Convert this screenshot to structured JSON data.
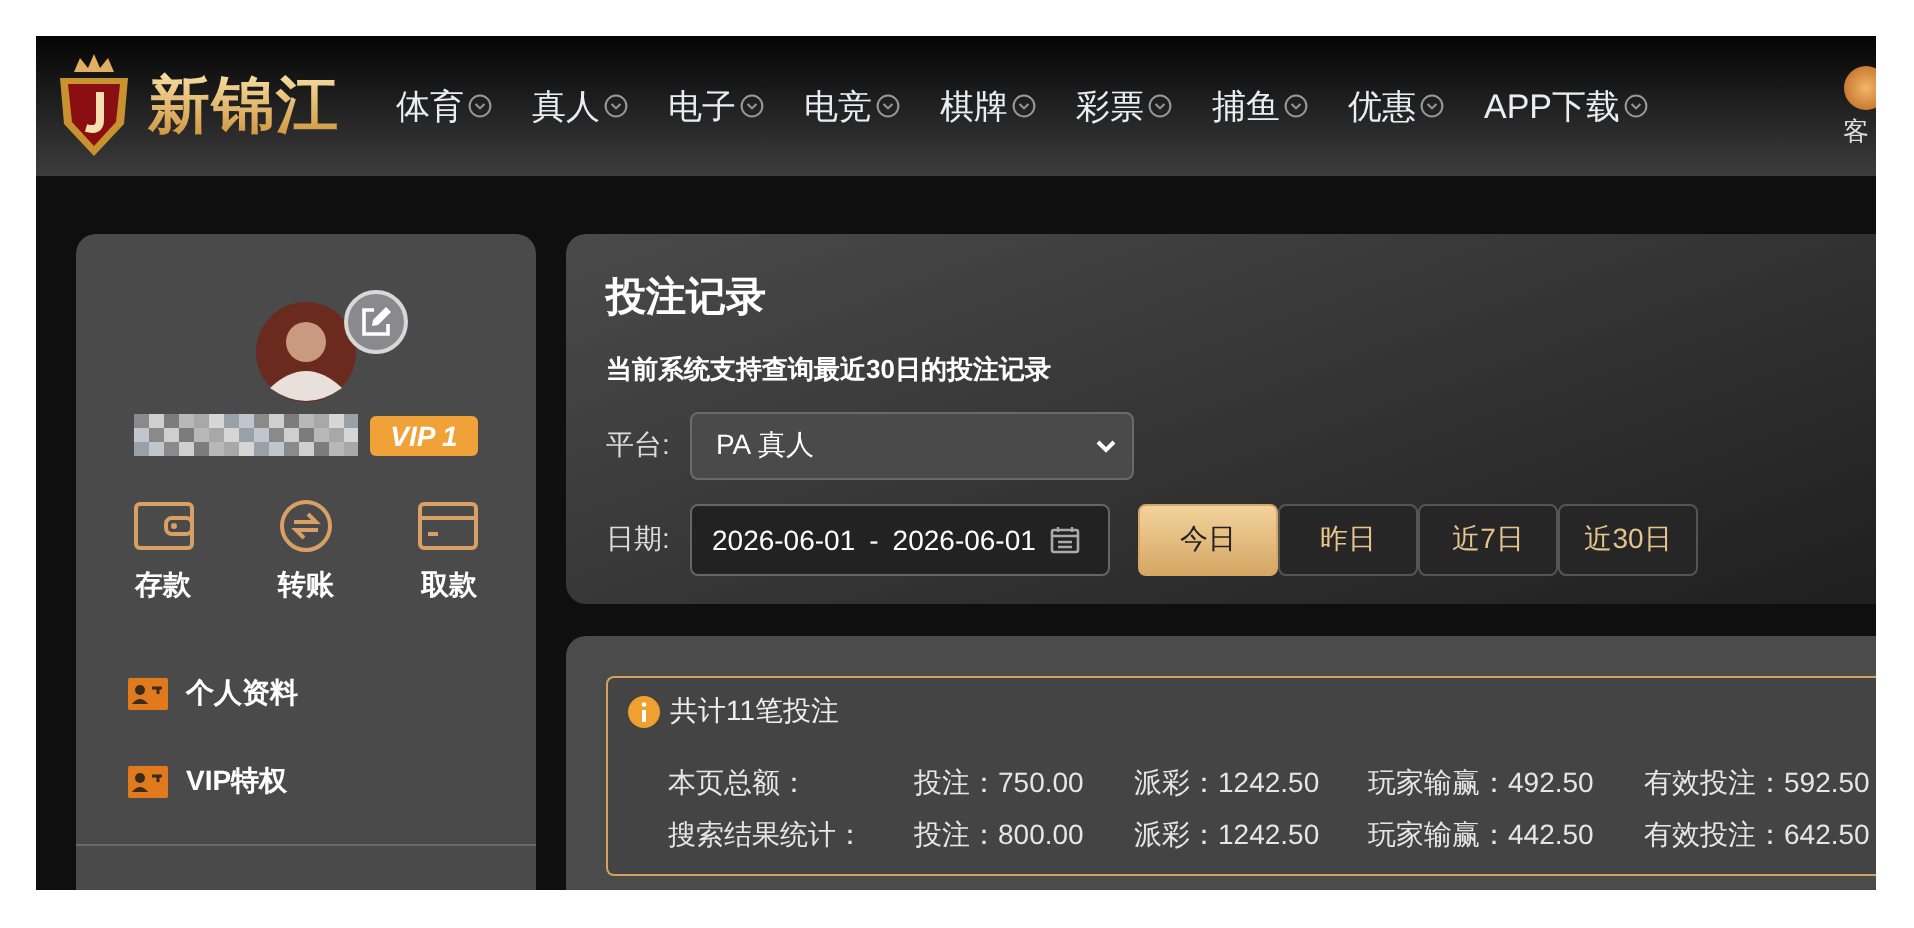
{
  "header": {
    "logo_text": "新锦江",
    "nav": [
      {
        "label": "体育"
      },
      {
        "label": "真人"
      },
      {
        "label": "电子"
      },
      {
        "label": "电竞"
      },
      {
        "label": "棋牌"
      },
      {
        "label": "彩票"
      },
      {
        "label": "捕鱼"
      },
      {
        "label": "优惠"
      },
      {
        "label": "APP下载"
      }
    ],
    "service_label": "客"
  },
  "sidebar": {
    "vip_badge": "VIP 1",
    "actions": [
      {
        "label": "存款",
        "kind": "wallet"
      },
      {
        "label": "转账",
        "kind": "transfer"
      },
      {
        "label": "取款",
        "kind": "card"
      }
    ],
    "menu": [
      {
        "label": "个人资料"
      },
      {
        "label": "VIP特权"
      }
    ]
  },
  "bet_records": {
    "title": "投注记录",
    "notice": "当前系统支持查询最近30日的投注记录",
    "platform": {
      "label": "平台:",
      "value": "PA 真人"
    },
    "date": {
      "label": "日期:",
      "start": "2026-06-01",
      "separator": "-",
      "end": "2026-06-01"
    },
    "ranges": [
      {
        "label": "今日",
        "selected": true
      },
      {
        "label": "昨日",
        "selected": false
      },
      {
        "label": "近7日",
        "selected": false
      },
      {
        "label": "近30日",
        "selected": false
      }
    ]
  },
  "summary": {
    "total": "共计11笔投注",
    "rows": [
      {
        "label": "本页总额：",
        "stats": [
          "投注：750.00",
          "派彩：1242.50",
          "玩家输赢：492.50",
          "有效投注：592.50"
        ]
      },
      {
        "label": "搜索结果统计：",
        "stats": [
          "投注：800.00",
          "派彩：1242.50",
          "玩家输赢：442.50",
          "有效投注：642.50"
        ]
      }
    ]
  }
}
